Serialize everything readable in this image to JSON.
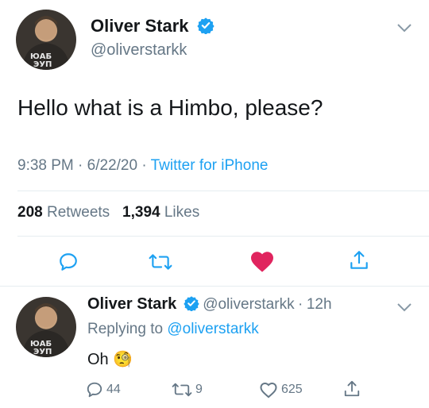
{
  "main_tweet": {
    "author_name": "Oliver Stark",
    "author_handle": "@oliverstarkk",
    "text": "Hello what is a Himbo, please?",
    "time": "9:38 PM",
    "date": "6/22/20",
    "source": "Twitter for iPhone",
    "retweets_count": "208",
    "retweets_label": "Retweets",
    "likes_count": "1,394",
    "likes_label": "Likes",
    "avatar_shirt_text": "ЮАБ\nЭУП",
    "liked": true
  },
  "reply_tweet": {
    "author_name": "Oliver Stark",
    "author_handle": "@oliverstarkk",
    "time_ago": "12h",
    "replying_label": "Replying to",
    "replying_to": "@oliverstarkk",
    "text": "Oh",
    "emoji": "🧐",
    "retweets_count": "9",
    "likes_count": "625",
    "replies_count": "44",
    "avatar_shirt_text": "ЮАБ\nЭУП"
  },
  "colors": {
    "accent": "#1da1f2",
    "like": "#e0245e",
    "muted": "#657786",
    "text": "#14171a"
  },
  "icons": [
    "verified-badge-icon",
    "chevron-down-icon",
    "reply-icon",
    "retweet-icon",
    "heart-icon",
    "share-icon"
  ]
}
